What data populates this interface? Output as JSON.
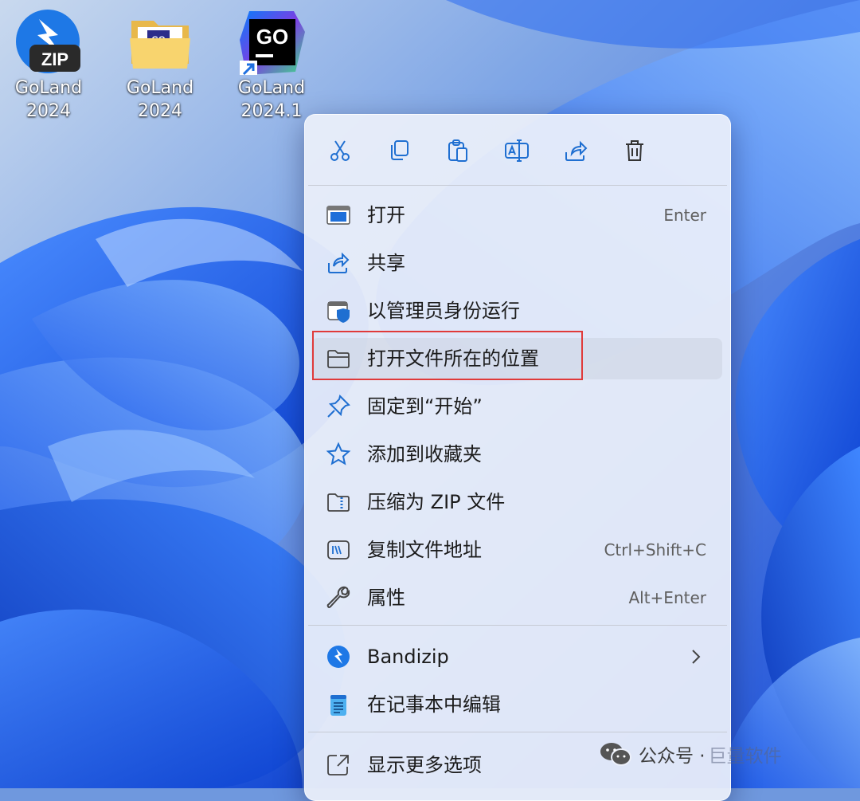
{
  "desktop": {
    "icons": [
      {
        "line1": "GoLand",
        "line2": "2024",
        "badge": "ZIP"
      },
      {
        "line1": "GoLand",
        "line2": "2024",
        "badge": "GO"
      },
      {
        "line1": "GoLand",
        "line2": "2024.1",
        "badge": "GO"
      }
    ]
  },
  "context_menu": {
    "toolbar": [
      "cut-icon",
      "copy-icon",
      "paste-icon",
      "rename-icon",
      "share-icon",
      "delete-icon"
    ],
    "items": [
      {
        "label": "打开",
        "shortcut": "Enter",
        "icon": "open-app-icon"
      },
      {
        "label": "共享",
        "shortcut": "",
        "icon": "share-icon"
      },
      {
        "label": "以管理员身份运行",
        "shortcut": "",
        "icon": "admin-shield-icon"
      },
      {
        "label": "打开文件所在的位置",
        "shortcut": "",
        "icon": "folder-icon"
      },
      {
        "label": "固定到“开始”",
        "shortcut": "",
        "icon": "pin-icon"
      },
      {
        "label": "添加到收藏夹",
        "shortcut": "",
        "icon": "star-icon"
      },
      {
        "label": "压缩为 ZIP 文件",
        "shortcut": "",
        "icon": "zip-folder-icon"
      },
      {
        "label": "复制文件地址",
        "shortcut": "Ctrl+Shift+C",
        "icon": "copy-path-icon"
      },
      {
        "label": "属性",
        "shortcut": "Alt+Enter",
        "icon": "wrench-icon"
      },
      {
        "label": "Bandizip",
        "shortcut": "",
        "icon": "bandizip-icon",
        "submenu": true
      },
      {
        "label": "在记事本中编辑",
        "shortcut": "",
        "icon": "notepad-icon"
      },
      {
        "label": "显示更多选项",
        "shortcut": "",
        "icon": "more-options-icon"
      }
    ]
  },
  "watermark": {
    "text": "公众号 ·",
    "dim_text": "巨量软件"
  },
  "colors": {
    "accent": "#0f6cbd",
    "highlight_border": "#e03a3a",
    "menu_bg": "#ecf0fa"
  }
}
